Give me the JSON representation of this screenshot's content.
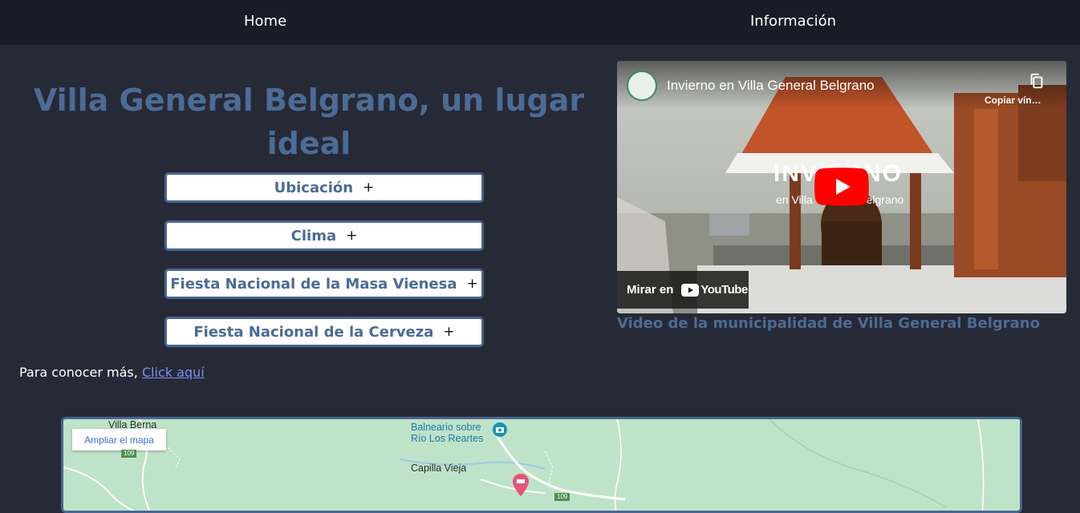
{
  "nav": {
    "home": "Home",
    "info": "Información"
  },
  "main": {
    "title": "Villa General Belgrano, un lugar ideal",
    "sections": [
      {
        "label": "Ubicación",
        "toggle": "+"
      },
      {
        "label": "Clima",
        "toggle": "+"
      },
      {
        "label": "Fiesta Nacional de la Masa Vienesa",
        "toggle": "+"
      },
      {
        "label": "Fiesta Nacional de la Cerveza",
        "toggle": "+"
      }
    ],
    "more_text": "Para conocer más,",
    "more_link": "Click aquí"
  },
  "video": {
    "title": "Invierno en Villa General Belgrano",
    "copy_label": "Copiar vín…",
    "watch_on": "Mirar en",
    "youtube": "YouTube",
    "caption": "Video de la municipalidad de Villa General Belgrano"
  },
  "map": {
    "enlarge": "Ampliar el mapa",
    "places": {
      "villa_berna": "Villa Berna",
      "balneario_line1": "Balneario sobre",
      "balneario_line2": "Río Los Reartes",
      "capilla_vieja": "Capilla Vieja"
    },
    "route_badges": [
      "109",
      "109"
    ]
  },
  "colors": {
    "background": "#262a36",
    "navbar": "#191c26",
    "accent": "#4c6b95",
    "link": "#7a8df0",
    "youtube_red": "#ff0000"
  },
  "icons": {
    "copy": "copy-icon",
    "play": "play-button-icon",
    "youtube": "youtube-logo-icon",
    "camera": "camera-pin-icon",
    "hotel": "hotel-pin-icon"
  }
}
